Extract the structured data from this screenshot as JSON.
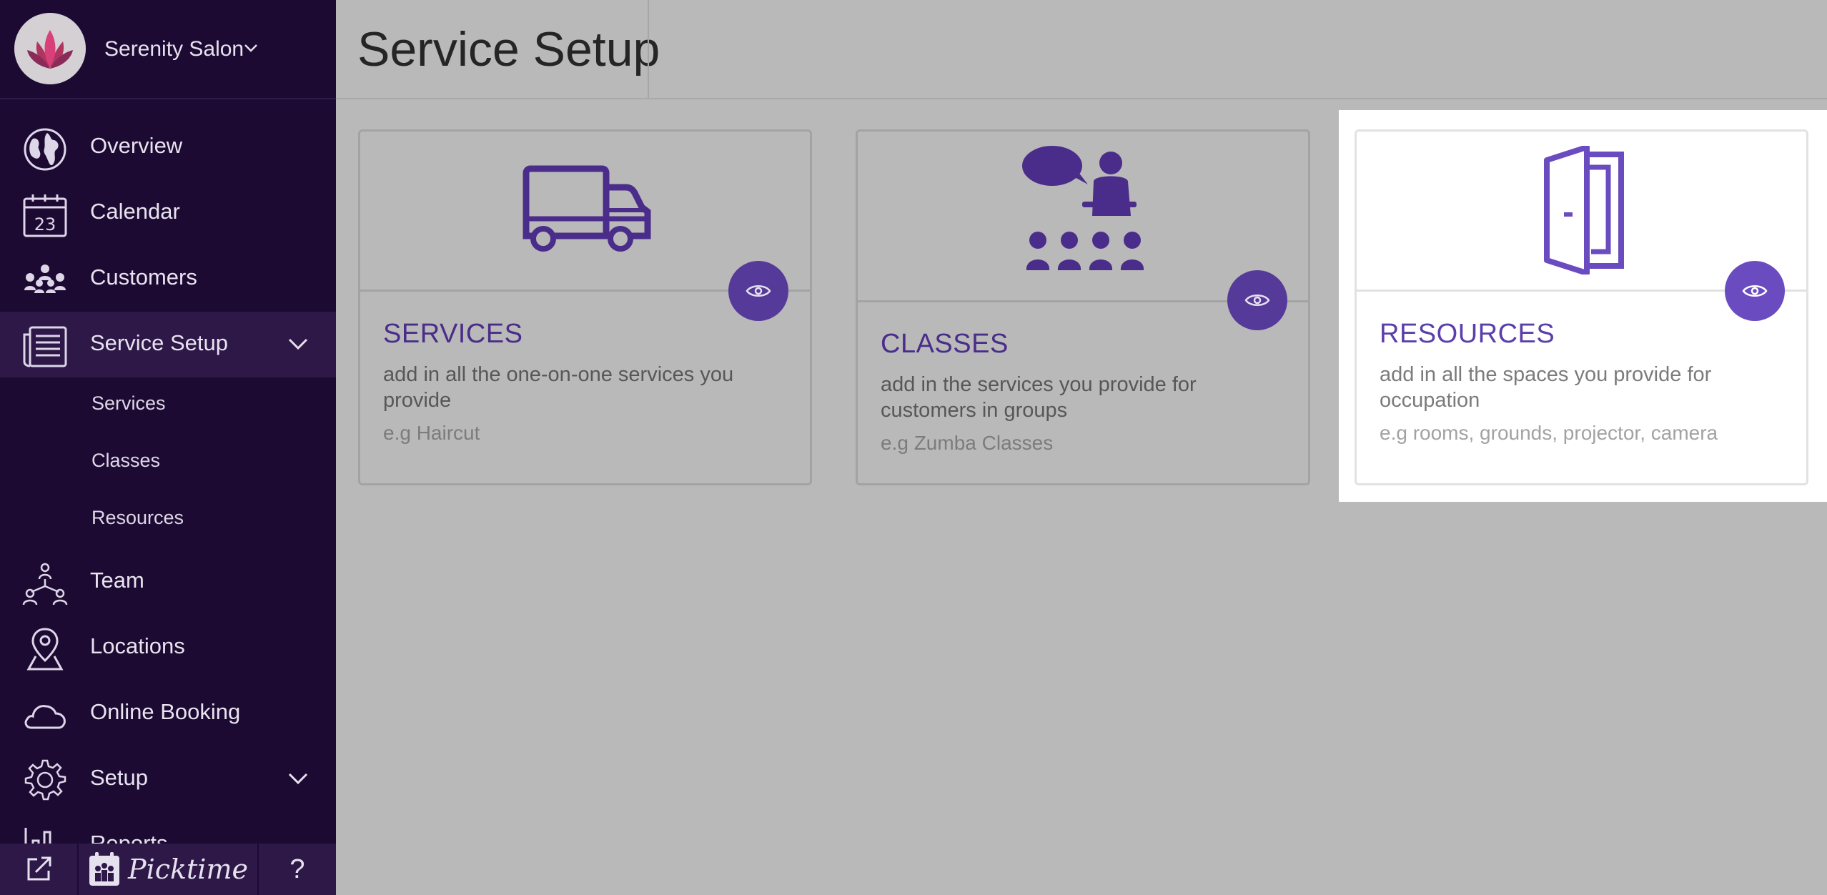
{
  "brand": {
    "name": "Serenity Salon"
  },
  "nav": {
    "overview": "Overview",
    "calendar": "Calendar",
    "calendar_date": "23",
    "customers": "Customers",
    "service_setup": "Service Setup",
    "sub_services": "Services",
    "sub_classes": "Classes",
    "sub_resources": "Resources",
    "team": "Team",
    "locations": "Locations",
    "online_booking": "Online Booking",
    "setup": "Setup",
    "reports": "Reports"
  },
  "footer": {
    "logo_text": "Picktime",
    "help": "?"
  },
  "header": {
    "title": "Service Setup"
  },
  "cards": [
    {
      "title": "SERVICES",
      "description": "add in all the one-on-one services you provide",
      "example": "e.g Haircut",
      "icon": "van-icon"
    },
    {
      "title": "CLASSES",
      "description": "add in the services you provide for customers in groups",
      "example": "e.g Zumba Classes",
      "icon": "class-group-icon"
    },
    {
      "title": "RESOURCES",
      "description": "add in all the spaces you provide for occupation",
      "example": "e.g rooms, grounds, projector, camera",
      "icon": "door-icon"
    }
  ],
  "colors": {
    "sidebar_bg": "#1d0a33",
    "accent": "#553a9a",
    "highlight": "#ffffff"
  }
}
